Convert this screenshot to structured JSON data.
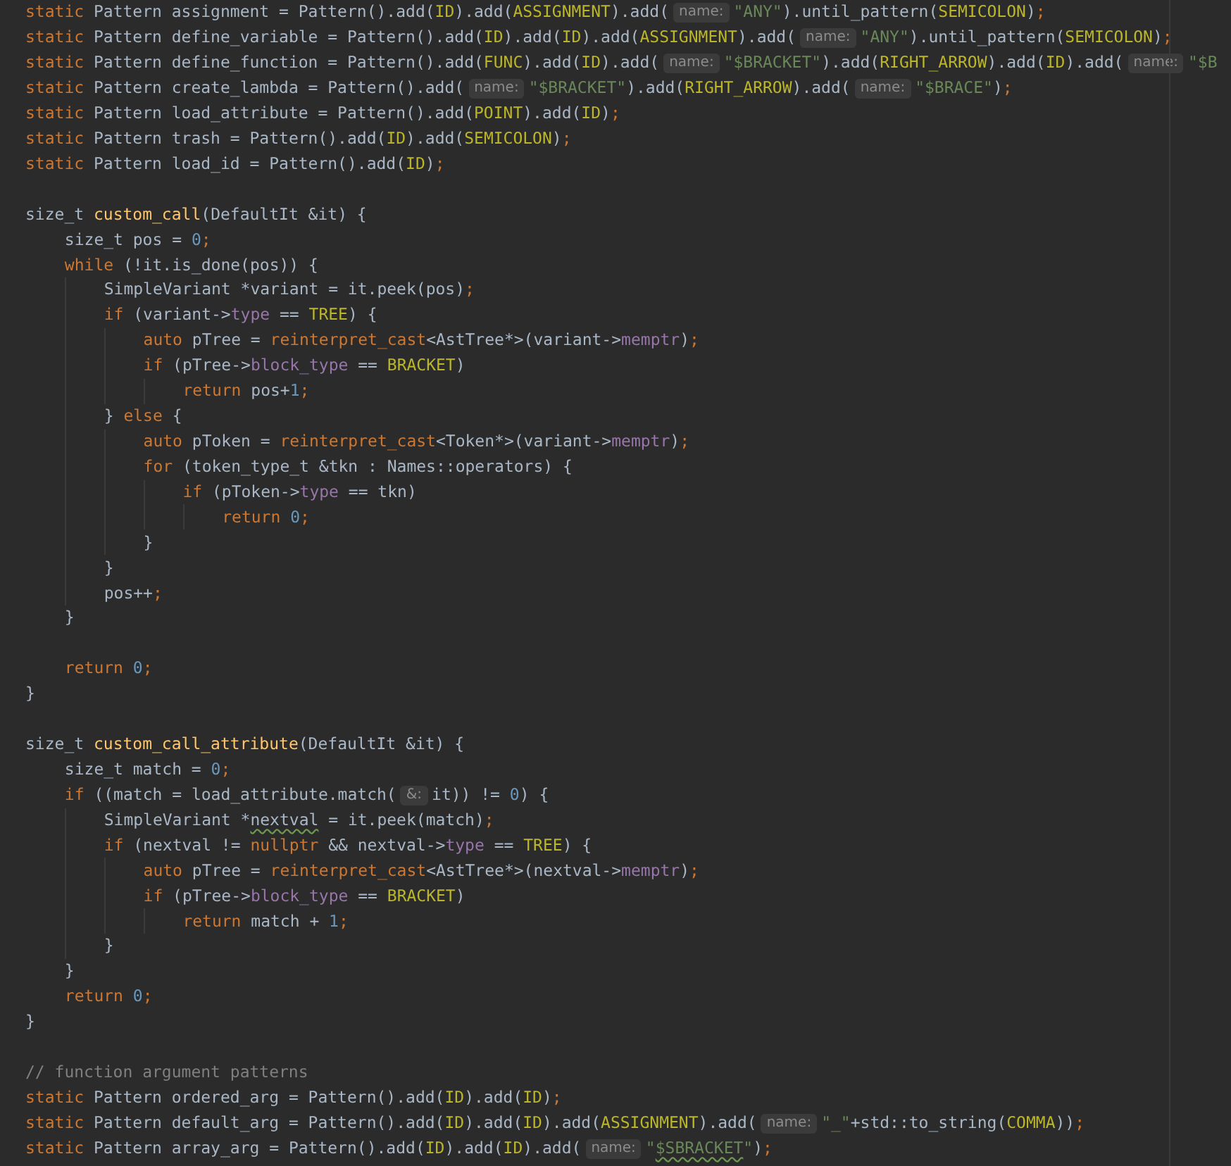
{
  "editor": {
    "lines": [
      {
        "tokens": [
          {
            "kind": "keyword",
            "text": "static "
          },
          {
            "kind": "plain",
            "text": "Pattern assignment = Pattern().add("
          },
          {
            "kind": "constant",
            "text": "ID"
          },
          {
            "kind": "plain",
            "text": ").add("
          },
          {
            "kind": "constant",
            "text": "ASSIGNMENT"
          },
          {
            "kind": "plain",
            "text": ").add("
          },
          {
            "kind": "hint",
            "text": "name:"
          },
          {
            "kind": "string",
            "text": "\"ANY\""
          },
          {
            "kind": "plain",
            "text": ").until_pattern("
          },
          {
            "kind": "constant",
            "text": "SEMICOLON"
          },
          {
            "kind": "plain",
            "text": ")"
          },
          {
            "kind": "keyword",
            "text": ";"
          }
        ]
      },
      {
        "tokens": [
          {
            "kind": "keyword",
            "text": "static "
          },
          {
            "kind": "plain",
            "text": "Pattern define_variable = Pattern().add("
          },
          {
            "kind": "constant",
            "text": "ID"
          },
          {
            "kind": "plain",
            "text": ").add("
          },
          {
            "kind": "constant",
            "text": "ID"
          },
          {
            "kind": "plain",
            "text": ").add("
          },
          {
            "kind": "constant",
            "text": "ASSIGNMENT"
          },
          {
            "kind": "plain",
            "text": ").add("
          },
          {
            "kind": "hint",
            "text": "name:"
          },
          {
            "kind": "string",
            "text": "\"ANY\""
          },
          {
            "kind": "plain",
            "text": ").until_pattern("
          },
          {
            "kind": "constant",
            "text": "SEMICOLON"
          },
          {
            "kind": "plain",
            "text": ")"
          },
          {
            "kind": "keyword",
            "text": ";"
          }
        ]
      },
      {
        "tokens": [
          {
            "kind": "keyword",
            "text": "static "
          },
          {
            "kind": "plain",
            "text": "Pattern define_function = Pattern().add("
          },
          {
            "kind": "constant",
            "text": "FUNC"
          },
          {
            "kind": "plain",
            "text": ").add("
          },
          {
            "kind": "constant",
            "text": "ID"
          },
          {
            "kind": "plain",
            "text": ").add("
          },
          {
            "kind": "hint",
            "text": "name:"
          },
          {
            "kind": "string",
            "text": "\"$BRACKET\""
          },
          {
            "kind": "plain",
            "text": ").add("
          },
          {
            "kind": "constant",
            "text": "RIGHT_ARROW"
          },
          {
            "kind": "plain",
            "text": ").add("
          },
          {
            "kind": "constant",
            "text": "ID"
          },
          {
            "kind": "plain",
            "text": ").add("
          },
          {
            "kind": "hint",
            "text": "name:"
          },
          {
            "kind": "string",
            "text": "\"$B"
          }
        ]
      },
      {
        "tokens": [
          {
            "kind": "keyword",
            "text": "static "
          },
          {
            "kind": "plain",
            "text": "Pattern create_lambda = Pattern().add("
          },
          {
            "kind": "hint",
            "text": "name:"
          },
          {
            "kind": "string",
            "text": "\"$BRACKET\""
          },
          {
            "kind": "plain",
            "text": ").add("
          },
          {
            "kind": "constant",
            "text": "RIGHT_ARROW"
          },
          {
            "kind": "plain",
            "text": ").add("
          },
          {
            "kind": "hint",
            "text": "name:"
          },
          {
            "kind": "string",
            "text": "\"$BRACE\""
          },
          {
            "kind": "plain",
            "text": ")"
          },
          {
            "kind": "keyword",
            "text": ";"
          }
        ]
      },
      {
        "tokens": [
          {
            "kind": "keyword",
            "text": "static "
          },
          {
            "kind": "plain",
            "text": "Pattern load_attribute = Pattern().add("
          },
          {
            "kind": "constant",
            "text": "POINT"
          },
          {
            "kind": "plain",
            "text": ").add("
          },
          {
            "kind": "constant",
            "text": "ID"
          },
          {
            "kind": "plain",
            "text": ")"
          },
          {
            "kind": "keyword",
            "text": ";"
          }
        ]
      },
      {
        "tokens": [
          {
            "kind": "keyword",
            "text": "static "
          },
          {
            "kind": "plain",
            "text": "Pattern trash = Pattern().add("
          },
          {
            "kind": "constant",
            "text": "ID"
          },
          {
            "kind": "plain",
            "text": ").add("
          },
          {
            "kind": "constant",
            "text": "SEMICOLON"
          },
          {
            "kind": "plain",
            "text": ")"
          },
          {
            "kind": "keyword",
            "text": ";"
          }
        ]
      },
      {
        "tokens": [
          {
            "kind": "keyword",
            "text": "static "
          },
          {
            "kind": "plain",
            "text": "Pattern load_id = Pattern().add("
          },
          {
            "kind": "constant",
            "text": "ID"
          },
          {
            "kind": "plain",
            "text": ")"
          },
          {
            "kind": "keyword",
            "text": ";"
          }
        ]
      },
      {
        "blank_before": true,
        "tokens": [
          {
            "kind": "plain",
            "text": "size_t "
          },
          {
            "kind": "function",
            "text": "custom_call"
          },
          {
            "kind": "plain",
            "text": "(DefaultIt &it) {"
          }
        ]
      },
      {
        "tokens": [
          {
            "kind": "plain",
            "text": "    size_t pos = "
          },
          {
            "kind": "number",
            "text": "0"
          },
          {
            "kind": "keyword",
            "text": ";"
          }
        ]
      },
      {
        "tokens": [
          {
            "kind": "keyword",
            "text": "    while "
          },
          {
            "kind": "plain",
            "text": "(!it.is_done(pos)) {"
          }
        ]
      },
      {
        "tokens": [
          {
            "kind": "plain",
            "text": "        SimpleVariant *variant = it.peek(pos)"
          },
          {
            "kind": "keyword",
            "text": ";"
          }
        ]
      },
      {
        "tokens": [
          {
            "kind": "keyword",
            "text": "        if "
          },
          {
            "kind": "plain",
            "text": "(variant->"
          },
          {
            "kind": "field",
            "text": "type"
          },
          {
            "kind": "plain",
            "text": " == "
          },
          {
            "kind": "constant",
            "text": "TREE"
          },
          {
            "kind": "plain",
            "text": ") {"
          }
        ]
      },
      {
        "tokens": [
          {
            "kind": "keyword",
            "text": "            auto "
          },
          {
            "kind": "plain",
            "text": "pTree = "
          },
          {
            "kind": "keyword",
            "text": "reinterpret_cast"
          },
          {
            "kind": "plain",
            "text": "<AstTree*>(variant->"
          },
          {
            "kind": "field",
            "text": "memptr"
          },
          {
            "kind": "plain",
            "text": ")"
          },
          {
            "kind": "keyword",
            "text": ";"
          }
        ]
      },
      {
        "tokens": [
          {
            "kind": "keyword",
            "text": "            if "
          },
          {
            "kind": "plain",
            "text": "(pTree->"
          },
          {
            "kind": "field",
            "text": "block_type"
          },
          {
            "kind": "plain",
            "text": " == "
          },
          {
            "kind": "constant",
            "text": "BRACKET"
          },
          {
            "kind": "plain",
            "text": ")"
          }
        ]
      },
      {
        "tokens": [
          {
            "kind": "keyword",
            "text": "                return "
          },
          {
            "kind": "plain",
            "text": "pos+"
          },
          {
            "kind": "number",
            "text": "1"
          },
          {
            "kind": "keyword",
            "text": ";"
          }
        ]
      },
      {
        "tokens": [
          {
            "kind": "plain",
            "text": "        } "
          },
          {
            "kind": "keyword",
            "text": "else "
          },
          {
            "kind": "plain",
            "text": "{"
          }
        ]
      },
      {
        "tokens": [
          {
            "kind": "keyword",
            "text": "            auto "
          },
          {
            "kind": "plain",
            "text": "pToken = "
          },
          {
            "kind": "keyword",
            "text": "reinterpret_cast"
          },
          {
            "kind": "plain",
            "text": "<Token*>(variant->"
          },
          {
            "kind": "field",
            "text": "memptr"
          },
          {
            "kind": "plain",
            "text": ")"
          },
          {
            "kind": "keyword",
            "text": ";"
          }
        ]
      },
      {
        "tokens": [
          {
            "kind": "keyword",
            "text": "            for "
          },
          {
            "kind": "plain",
            "text": "(token_type_t &tkn : Names::operators) {"
          }
        ]
      },
      {
        "tokens": [
          {
            "kind": "keyword",
            "text": "                if "
          },
          {
            "kind": "plain",
            "text": "(pToken->"
          },
          {
            "kind": "field",
            "text": "type"
          },
          {
            "kind": "plain",
            "text": " == tkn)"
          }
        ]
      },
      {
        "tokens": [
          {
            "kind": "keyword",
            "text": "                    return "
          },
          {
            "kind": "number",
            "text": "0"
          },
          {
            "kind": "keyword",
            "text": ";"
          }
        ]
      },
      {
        "tokens": [
          {
            "kind": "plain",
            "text": "            }"
          }
        ]
      },
      {
        "tokens": [
          {
            "kind": "plain",
            "text": "        }"
          }
        ]
      },
      {
        "tokens": [
          {
            "kind": "plain",
            "text": "        pos++"
          },
          {
            "kind": "keyword",
            "text": ";"
          }
        ]
      },
      {
        "tokens": [
          {
            "kind": "plain",
            "text": "    }"
          }
        ]
      },
      {
        "blank_before": true,
        "tokens": [
          {
            "kind": "keyword",
            "text": "    return "
          },
          {
            "kind": "number",
            "text": "0"
          },
          {
            "kind": "keyword",
            "text": ";"
          }
        ]
      },
      {
        "tokens": [
          {
            "kind": "plain",
            "text": "}"
          }
        ]
      },
      {
        "blank_before": true,
        "tokens": [
          {
            "kind": "plain",
            "text": "size_t "
          },
          {
            "kind": "function",
            "text": "custom_call_attribute"
          },
          {
            "kind": "plain",
            "text": "(DefaultIt &it) {"
          }
        ]
      },
      {
        "tokens": [
          {
            "kind": "plain",
            "text": "    size_t match = "
          },
          {
            "kind": "number",
            "text": "0"
          },
          {
            "kind": "keyword",
            "text": ";"
          }
        ]
      },
      {
        "tokens": [
          {
            "kind": "keyword",
            "text": "    if "
          },
          {
            "kind": "plain",
            "text": "((match = load_attribute.match("
          },
          {
            "kind": "hint",
            "text": "&:"
          },
          {
            "kind": "plain",
            "text": "it)) != "
          },
          {
            "kind": "number",
            "text": "0"
          },
          {
            "kind": "plain",
            "text": ") {"
          }
        ]
      },
      {
        "tokens": [
          {
            "kind": "plain",
            "text": "        SimpleVariant *"
          },
          {
            "kind": "plain",
            "text": "nextval",
            "squiggle": true
          },
          {
            "kind": "plain",
            "text": " = it.peek(match)"
          },
          {
            "kind": "keyword",
            "text": ";"
          }
        ]
      },
      {
        "tokens": [
          {
            "kind": "keyword",
            "text": "        if "
          },
          {
            "kind": "plain",
            "text": "(nextval != "
          },
          {
            "kind": "keyword",
            "text": "nullptr "
          },
          {
            "kind": "plain",
            "text": "&& nextval->"
          },
          {
            "kind": "field",
            "text": "type"
          },
          {
            "kind": "plain",
            "text": " == "
          },
          {
            "kind": "constant",
            "text": "TREE"
          },
          {
            "kind": "plain",
            "text": ") {"
          }
        ]
      },
      {
        "tokens": [
          {
            "kind": "keyword",
            "text": "            auto "
          },
          {
            "kind": "plain",
            "text": "pTree = "
          },
          {
            "kind": "keyword",
            "text": "reinterpret_cast"
          },
          {
            "kind": "plain",
            "text": "<AstTree*>(nextval->"
          },
          {
            "kind": "field",
            "text": "memptr"
          },
          {
            "kind": "plain",
            "text": ")"
          },
          {
            "kind": "keyword",
            "text": ";"
          }
        ]
      },
      {
        "tokens": [
          {
            "kind": "keyword",
            "text": "            if "
          },
          {
            "kind": "plain",
            "text": "(pTree->"
          },
          {
            "kind": "field",
            "text": "block_type"
          },
          {
            "kind": "plain",
            "text": " == "
          },
          {
            "kind": "constant",
            "text": "BRACKET"
          },
          {
            "kind": "plain",
            "text": ")"
          }
        ]
      },
      {
        "tokens": [
          {
            "kind": "keyword",
            "text": "                return "
          },
          {
            "kind": "plain",
            "text": "match + "
          },
          {
            "kind": "number",
            "text": "1"
          },
          {
            "kind": "keyword",
            "text": ";"
          }
        ]
      },
      {
        "tokens": [
          {
            "kind": "plain",
            "text": "        }"
          }
        ]
      },
      {
        "tokens": [
          {
            "kind": "plain",
            "text": "    }"
          }
        ]
      },
      {
        "tokens": [
          {
            "kind": "keyword",
            "text": "    return "
          },
          {
            "kind": "number",
            "text": "0"
          },
          {
            "kind": "keyword",
            "text": ";"
          }
        ]
      },
      {
        "tokens": [
          {
            "kind": "plain",
            "text": "}"
          }
        ]
      },
      {
        "blank_before": true,
        "tokens": [
          {
            "kind": "comment",
            "text": "// function argument patterns"
          }
        ]
      },
      {
        "tokens": [
          {
            "kind": "keyword",
            "text": "static "
          },
          {
            "kind": "plain",
            "text": "Pattern ordered_arg = Pattern().add("
          },
          {
            "kind": "constant",
            "text": "ID"
          },
          {
            "kind": "plain",
            "text": ").add("
          },
          {
            "kind": "constant",
            "text": "ID"
          },
          {
            "kind": "plain",
            "text": ")"
          },
          {
            "kind": "keyword",
            "text": ";"
          }
        ]
      },
      {
        "tokens": [
          {
            "kind": "keyword",
            "text": "static "
          },
          {
            "kind": "plain",
            "text": "Pattern default_arg = Pattern().add("
          },
          {
            "kind": "constant",
            "text": "ID"
          },
          {
            "kind": "plain",
            "text": ").add("
          },
          {
            "kind": "constant",
            "text": "ID"
          },
          {
            "kind": "plain",
            "text": ").add("
          },
          {
            "kind": "constant",
            "text": "ASSIGNMENT"
          },
          {
            "kind": "plain",
            "text": ").add("
          },
          {
            "kind": "hint",
            "text": "name:"
          },
          {
            "kind": "string",
            "text": "\"_\""
          },
          {
            "kind": "plain",
            "text": "+std::to_string("
          },
          {
            "kind": "constant",
            "text": "COMMA"
          },
          {
            "kind": "plain",
            "text": "))"
          },
          {
            "kind": "keyword",
            "text": ";"
          }
        ]
      },
      {
        "tokens": [
          {
            "kind": "keyword",
            "text": "static "
          },
          {
            "kind": "plain",
            "text": "Pattern array_arg = Pattern().add("
          },
          {
            "kind": "constant",
            "text": "ID"
          },
          {
            "kind": "plain",
            "text": ").add("
          },
          {
            "kind": "constant",
            "text": "ID"
          },
          {
            "kind": "plain",
            "text": ").add("
          },
          {
            "kind": "hint",
            "text": "name:"
          },
          {
            "kind": "string",
            "text": "\""
          },
          {
            "kind": "string",
            "text": "$SBRACKET",
            "squiggle": true
          },
          {
            "kind": "string",
            "text": "\""
          },
          {
            "kind": "plain",
            "text": ")"
          },
          {
            "kind": "keyword",
            "text": ";"
          }
        ]
      }
    ]
  }
}
